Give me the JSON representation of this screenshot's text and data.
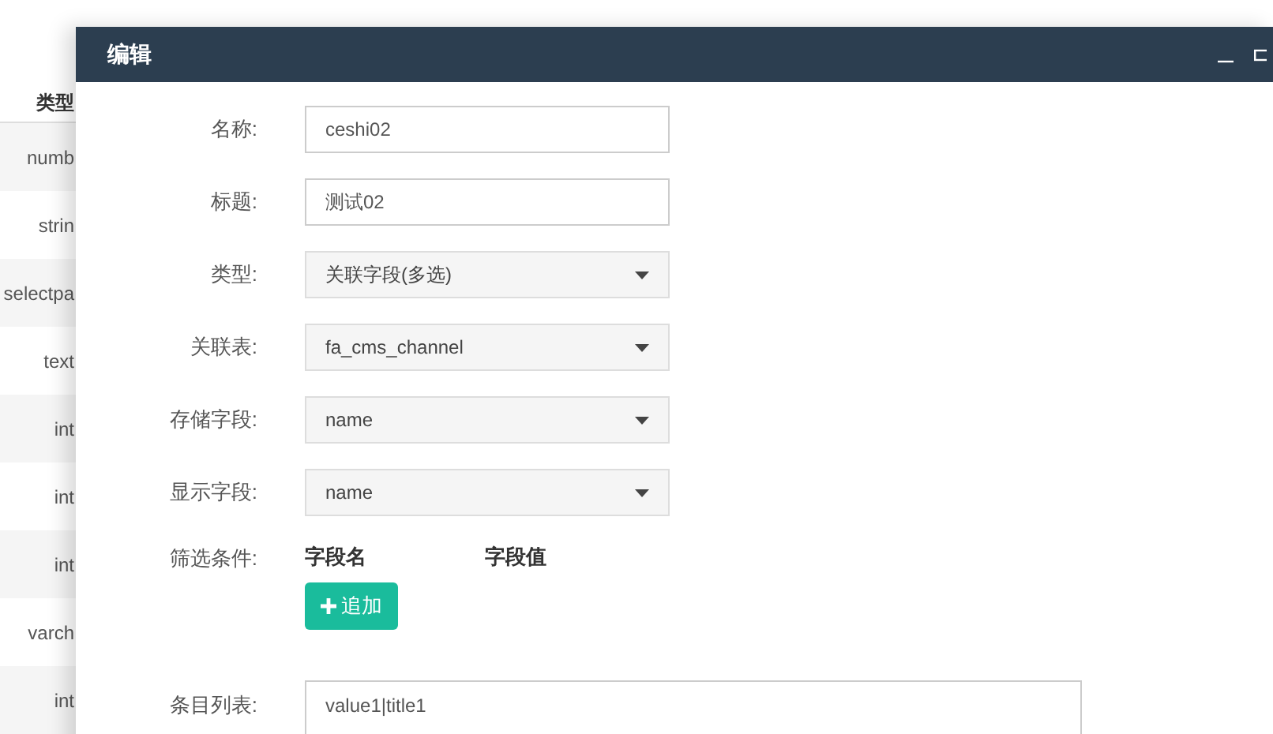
{
  "background_table": {
    "header": "类型",
    "rows": [
      "numb",
      "strin",
      "selectpa",
      "text",
      "int",
      "int",
      "int",
      "varch",
      "int"
    ]
  },
  "dialog": {
    "title": "编辑",
    "fields": [
      {
        "kind": "input",
        "label": "名称:",
        "value": "ceshi02"
      },
      {
        "kind": "input",
        "label": "标题:",
        "value": "测试02"
      },
      {
        "kind": "select",
        "label": "类型:",
        "value": "关联字段(多选)"
      },
      {
        "kind": "select",
        "label": "关联表:",
        "value": "fa_cms_channel"
      },
      {
        "kind": "select",
        "label": "存储字段:",
        "value": "name"
      },
      {
        "kind": "select",
        "label": "显示字段:",
        "value": "name"
      }
    ],
    "filter": {
      "label": "筛选条件:",
      "columns": [
        "字段名",
        "字段值"
      ],
      "add_button": "追加"
    },
    "items": {
      "label": "条目列表:",
      "value": "value1|title1"
    }
  }
}
